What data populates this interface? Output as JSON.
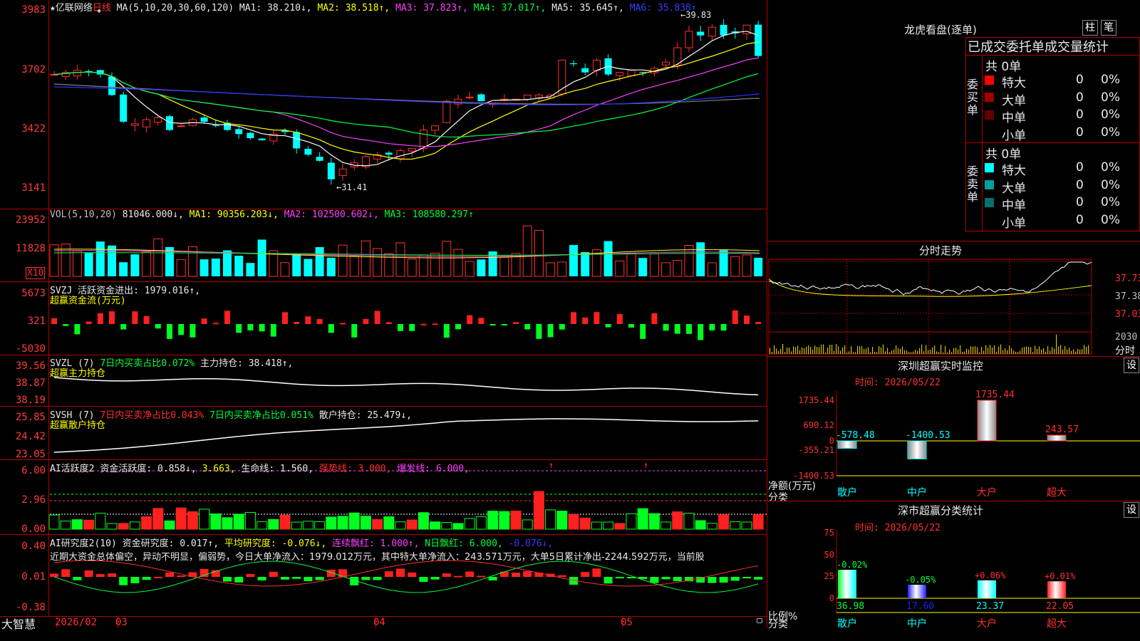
{
  "stock": {
    "star": "★",
    "name": "亿联网络",
    "period": "日线",
    "hover_plus": "✚"
  },
  "ma_line": {
    "label": "MA(5,10,20,30,60,120)",
    "ma1": "MA1: 38.210↓,",
    "ma2": "MA2: 38.518↑,",
    "ma3": "MA3: 37.823↑,",
    "ma4": "MA4: 37.017↑,",
    "ma5": "MA5: 35.645↑,",
    "ma6": "MA6: 35.838↑"
  },
  "price_axis": [
    "3983",
    "3702",
    "3422",
    "3141"
  ],
  "price_marks": {
    "high": "←39.83",
    "low": "←31.41"
  },
  "vol_line": {
    "label": "VOL(5,10,20)",
    "value": "81046.000↓,",
    "ma1": "MA1: 90356.203↓,",
    "ma2": "MA2: 102500.602↓,",
    "ma3": "MA3: 108580.297↑"
  },
  "vol_axis": [
    "23952",
    "11828"
  ],
  "vol_unit": "X10",
  "svzj": {
    "label": "SVZJ  活跃资金进出: 1979.016↑,",
    "sub": "超赢资金流(万元)",
    "axis": [
      "5673",
      "321",
      "-5030"
    ]
  },
  "svzl": {
    "label": "SVZL (7)",
    "p1": "7日内买卖占比0.072%",
    "p2": "主力持仓: 38.418↑,",
    "sub": "超赢主力持仓",
    "axis": [
      "39.56",
      "38.87",
      "38.19"
    ]
  },
  "svsh": {
    "label": "SVSH (7)",
    "p1": "7日内买卖净占比0.043%",
    "p2": "7日内买卖净占比0.051%",
    "p3": "散户持仓: 25.479↓,",
    "sub": "超赢散户持仓",
    "axis": [
      "25.85",
      "24.42",
      "23.05"
    ]
  },
  "ai2": {
    "label": "AI活跃度2",
    "p1": "资金活跃度: 0.858↓,",
    "p2": "3.663,",
    "p3": "生命线: 1.560,",
    "p4": "强势线: 3.000,",
    "p5": "爆发线: 6.000,",
    "axis": [
      "6.00",
      "2.96",
      "0.00"
    ]
  },
  "ai_research": {
    "label": "AI研究度2(10)",
    "p1": "资金研究度: 0.017↑,",
    "p2": "平均研究度: -0.076↓,",
    "p3": "连续飘红: 1.000↑,",
    "p4": "N日飘红: 6.000,",
    "p5": "-0.076↓,",
    "desc": "近期大资金总体偏空，异动不明显，偏弱势，今日大单净流入：1979.012万元，其中特大单净流入：243.571万元，大单5日累计净出-2244.592万元，当前股",
    "axis": [
      "0.40",
      "0.01",
      "-0.38"
    ]
  },
  "bottom": {
    "logo": "大智慧",
    "dates": [
      "2026/02",
      "03",
      "04",
      "05"
    ]
  },
  "lhb": {
    "title": "龙虎看盘(逐单)",
    "btn1": "柱",
    "btn2": "笔",
    "header": "已成交委托单成交量统计",
    "buy_side": "委买单",
    "sell_side": "委卖单",
    "buy_total": "共 0单",
    "sell_total": "共 0单",
    "buy_rows": [
      {
        "name": "特大",
        "val": "0",
        "pct": "0%",
        "color": "#ff0000"
      },
      {
        "name": "大单",
        "val": "0",
        "pct": "0%",
        "color": "#a00000"
      },
      {
        "name": "中单",
        "val": "0",
        "pct": "0%",
        "color": "#600000"
      },
      {
        "name": "小单",
        "val": "0",
        "pct": "0%",
        "color": "#000000"
      }
    ],
    "sell_rows": [
      {
        "name": "特大",
        "val": "0",
        "pct": "0%",
        "color": "#00ffff"
      },
      {
        "name": "大单",
        "val": "0",
        "pct": "0%",
        "color": "#00a0a0"
      },
      {
        "name": "中单",
        "val": "0",
        "pct": "0%",
        "color": "#007070"
      },
      {
        "name": "小单",
        "val": "0",
        "pct": "0%",
        "color": "#000000"
      }
    ]
  },
  "intraday": {
    "title": "分时走势",
    "axis": [
      "37.73",
      "37.38",
      "37.03"
    ],
    "vol_label": "2030",
    "unit": "分时"
  },
  "monitor": {
    "title": "深圳超赢实时监控",
    "btn": "设",
    "time": "时间: 2026/05/22",
    "axis": [
      "1735.44",
      "690.12",
      "0",
      "-355.21",
      "-1400.53"
    ],
    "ylabel": "净额(万元)",
    "xlabel": "分类",
    "chart_data": {
      "type": "bar",
      "categories": [
        "散户",
        "中户",
        "大户",
        "超大"
      ],
      "values": [
        -578.48,
        -1400.53,
        1735.44,
        243.57
      ],
      "labels": [
        "-578.48",
        "-1400.53",
        "1735.44",
        "243.57"
      ]
    }
  },
  "stats": {
    "title": "深市超赢分类统计",
    "btn": "设",
    "time": "时间: 2026/05/22",
    "axis": [
      "75",
      "50",
      "25",
      "0"
    ],
    "ylabel": "比例%",
    "xlabel": "分类",
    "chart_data": {
      "type": "bar",
      "categories": [
        "散户",
        "中户",
        "大户",
        "超大"
      ],
      "values": [
        36.98,
        17.6,
        23.37,
        22.05
      ],
      "deltas": [
        "-0.02%",
        "-0.05%",
        "+0.06%",
        "+0.01%"
      ],
      "labels": [
        "36.98",
        "17.60",
        "23.37",
        "22.05"
      ]
    }
  }
}
